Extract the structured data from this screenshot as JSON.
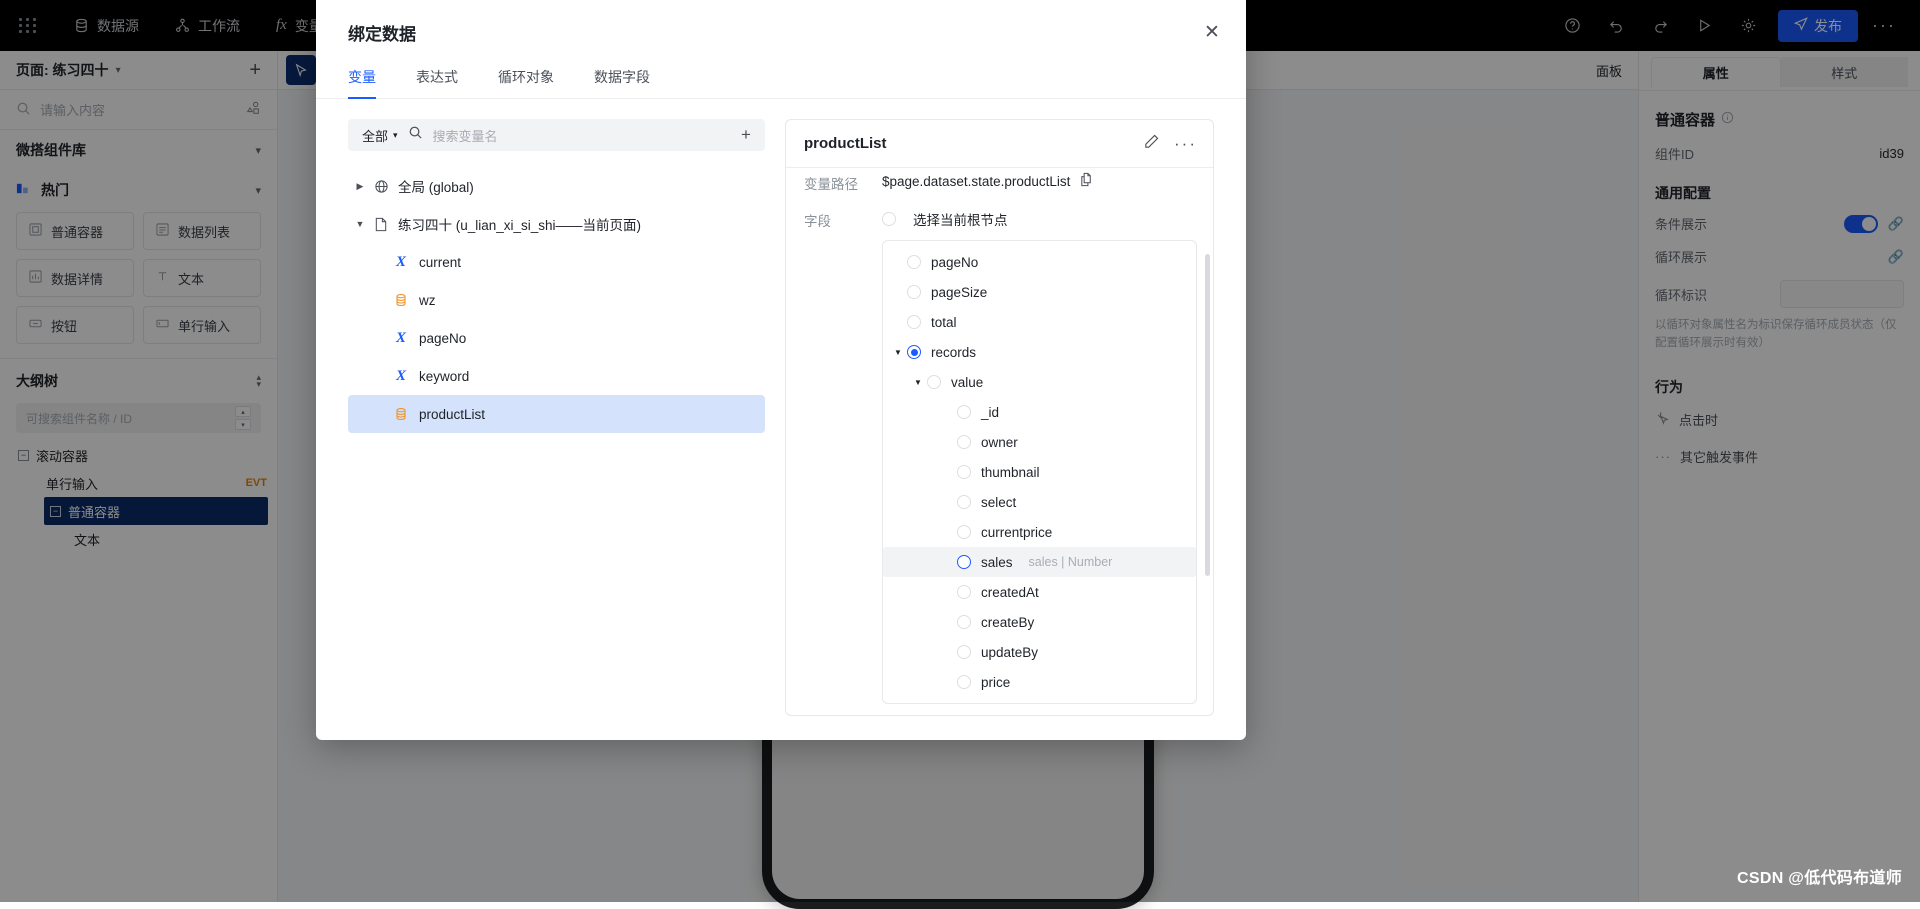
{
  "app": {
    "topbar": {
      "items": [
        {
          "label": "数据源",
          "icon": "database-icon"
        },
        {
          "label": "工作流",
          "icon": "workflow-icon"
        },
        {
          "label": "变量",
          "icon": "fx-icon"
        }
      ],
      "publish_label": "发布",
      "more_label": "···"
    },
    "left_panel": {
      "page_label": "页面: 练习四十",
      "search_placeholder": "请输入内容",
      "library_title": "微搭组件库",
      "group_title": "热门",
      "components": [
        "普通容器",
        "数据列表",
        "数据详情",
        "文本",
        "按钮",
        "单行输入"
      ],
      "outline_title": "大纲树",
      "outline_search_placeholder": "可搜索组件名称 / ID",
      "outline_nodes": [
        {
          "label": "滚动容器",
          "level": 0,
          "selected": false,
          "badge": ""
        },
        {
          "label": "单行输入",
          "level": 1,
          "selected": false,
          "badge": "EVT"
        },
        {
          "label": "普通容器",
          "level": 1,
          "selected": true,
          "badge": ""
        },
        {
          "label": "文本",
          "level": 2,
          "selected": false,
          "badge": ""
        }
      ]
    },
    "canvas": {
      "panel_label": "面板"
    },
    "right_panel": {
      "tabs": [
        {
          "label": "属性",
          "active": true
        },
        {
          "label": "样式",
          "active": false
        }
      ],
      "title": "普通容器",
      "component_id_label": "组件ID",
      "component_id_value": "id39",
      "general_title": "通用配置",
      "fields": [
        {
          "label": "条件展示",
          "type": "switch"
        },
        {
          "label": "循环展示",
          "type": "link"
        },
        {
          "label": "循环标识",
          "type": "input"
        }
      ],
      "loop_hint": "以循环对象属性名为标识保存循环成员状态（仅配置循环展示时有效）",
      "behavior_title": "行为",
      "behavior_items": [
        "点击时",
        "其它触发事件"
      ]
    },
    "watermark": "CSDN @低代码布道师"
  },
  "modal": {
    "title": "绑定数据",
    "close_icon": "close-icon",
    "tabs": [
      {
        "label": "变量",
        "active": true
      },
      {
        "label": "表达式",
        "active": false
      },
      {
        "label": "循环对象",
        "active": false
      },
      {
        "label": "数据字段",
        "active": false
      }
    ],
    "search": {
      "scope_label": "全部",
      "placeholder": "搜索变量名",
      "add_label": "+"
    },
    "tree": [
      {
        "label": "全局 (global)",
        "level": 1,
        "icon": "globe-icon",
        "caret": "collapsed",
        "selected": false
      },
      {
        "label": "练习四十 (u_lian_xi_si_shi——当前页面)",
        "level": 1,
        "icon": "page-icon",
        "caret": "expanded",
        "selected": false
      },
      {
        "label": "current",
        "level": 2,
        "icon": "x-var-icon",
        "caret": "none",
        "selected": false
      },
      {
        "label": "wz",
        "level": 2,
        "icon": "db-var-icon",
        "caret": "none",
        "selected": false
      },
      {
        "label": "pageNo",
        "level": 2,
        "icon": "x-var-icon",
        "caret": "none",
        "selected": false
      },
      {
        "label": "keyword",
        "level": 2,
        "icon": "x-var-icon",
        "caret": "none",
        "selected": false
      },
      {
        "label": "productList",
        "level": 2,
        "icon": "db-var-icon",
        "caret": "none",
        "selected": true
      }
    ],
    "detail": {
      "name": "productList",
      "edit_icon": "pencil-icon",
      "more_icon": "ellipsis-icon",
      "path_label": "变量路径",
      "path_value": "$page.dataset.state.productList",
      "copy_icon": "copy-icon",
      "field_label": "字段",
      "root_option_label": "选择当前根节点",
      "root_selected": false,
      "fields": [
        {
          "label": "pageNo",
          "indent": 0,
          "caret": "none",
          "state": "off",
          "hint": "",
          "hovered": false
        },
        {
          "label": "pageSize",
          "indent": 0,
          "caret": "none",
          "state": "off",
          "hint": "",
          "hovered": false
        },
        {
          "label": "total",
          "indent": 0,
          "caret": "none",
          "state": "off",
          "hint": "",
          "hovered": false
        },
        {
          "label": "records",
          "indent": 0,
          "caret": "expanded",
          "state": "on",
          "hint": "",
          "hovered": false
        },
        {
          "label": "value",
          "indent": 1,
          "caret": "expanded",
          "state": "off",
          "hint": "",
          "hovered": false
        },
        {
          "label": "_id",
          "indent": 2,
          "caret": "none",
          "state": "off",
          "hint": "",
          "hovered": false
        },
        {
          "label": "owner",
          "indent": 2,
          "caret": "none",
          "state": "off",
          "hint": "",
          "hovered": false
        },
        {
          "label": "thumbnail",
          "indent": 2,
          "caret": "none",
          "state": "off",
          "hint": "",
          "hovered": false
        },
        {
          "label": "select",
          "indent": 2,
          "caret": "none",
          "state": "off",
          "hint": "",
          "hovered": false
        },
        {
          "label": "currentprice",
          "indent": 2,
          "caret": "none",
          "state": "off",
          "hint": "",
          "hovered": false
        },
        {
          "label": "sales",
          "indent": 2,
          "caret": "none",
          "state": "ring",
          "hint": "sales | Number",
          "hovered": true
        },
        {
          "label": "createdAt",
          "indent": 2,
          "caret": "none",
          "state": "off",
          "hint": "",
          "hovered": false
        },
        {
          "label": "createBy",
          "indent": 2,
          "caret": "none",
          "state": "off",
          "hint": "",
          "hovered": false
        },
        {
          "label": "updateBy",
          "indent": 2,
          "caret": "none",
          "state": "off",
          "hint": "",
          "hovered": false
        },
        {
          "label": "price",
          "indent": 2,
          "caret": "none",
          "state": "off",
          "hint": "",
          "hovered": false
        }
      ]
    }
  },
  "colors": {
    "accent": "#1b5cff",
    "selected_row": "#d5e2fb",
    "topbar_bg": "#000000",
    "orange": "#f0932b"
  }
}
